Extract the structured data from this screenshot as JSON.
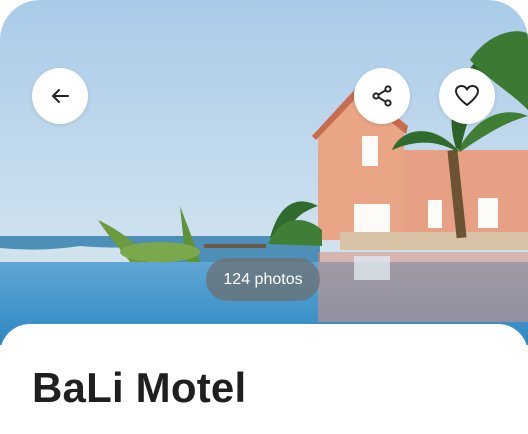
{
  "listing": {
    "name": "BaLi Motel",
    "photo_count_label": "124 photos"
  },
  "actions": {
    "back_icon": "arrow-left-icon",
    "share_icon": "share-icon",
    "favorite_icon": "heart-icon"
  },
  "colors": {
    "sheet": "#ffffff",
    "title": "#1f1f1f",
    "pill": "#6e6e6e"
  }
}
